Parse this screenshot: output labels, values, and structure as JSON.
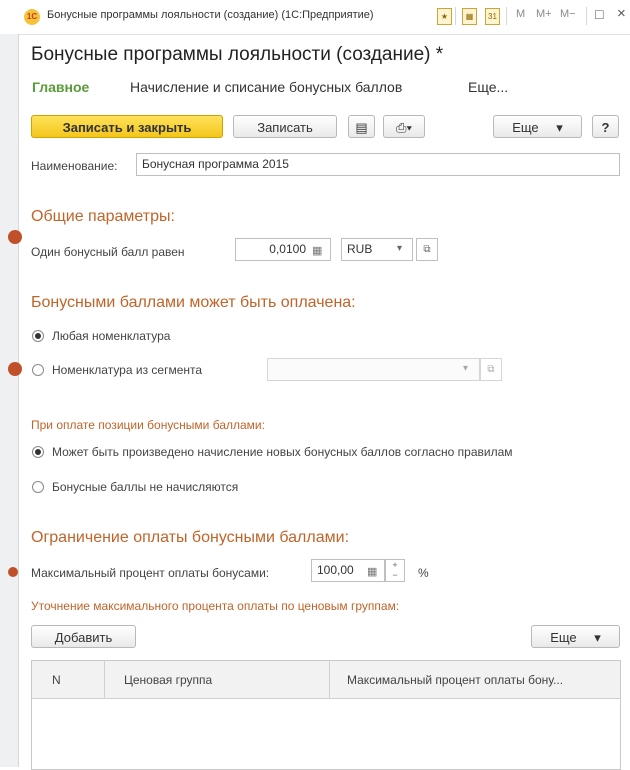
{
  "window": {
    "title": "Бонусные программы лояльности (создание)  (1С:Предприятие)",
    "title_icons": [
      "М",
      "М+",
      "М−"
    ],
    "maximize_glyph": "□",
    "close_glyph": "×"
  },
  "form": {
    "title": "Бонусные программы лояльности (создание) *"
  },
  "tabs": [
    {
      "label": "Главное"
    },
    {
      "label": "Начисление и списание бонусных баллов"
    },
    {
      "label": "Еще..."
    }
  ],
  "toolbar": {
    "save_close_label": "Записать и закрыть",
    "save_label": "Записать",
    "more_label": "Еще",
    "help_label": "?"
  },
  "name_field": {
    "label": "Наименование:",
    "value": "Бонусная программа 2015"
  },
  "general": {
    "heading": "Общие параметры:",
    "point_value_label": "Один бонусный балл равен",
    "point_value": "0,0100",
    "currency": "RUB"
  },
  "payable": {
    "heading": "Бонусными баллами может быть оплачена:",
    "option_any": "Любая номенклатура",
    "option_segment": "Номенклатура из сегмента",
    "segment_value": "",
    "selected": "any"
  },
  "payment": {
    "heading": "При оплате позиции бонусными баллами:",
    "option_accrue": "Может быть произведено начисление новых бонусных баллов согласно правилам",
    "option_no_accrue": "Бонусные баллы не начисляются",
    "selected": "accrue"
  },
  "limit": {
    "heading": "Ограничение оплаты бонусными баллами:",
    "max_percent_label": "Максимальный процент оплаты бонусами:",
    "max_percent": "100,00",
    "percent_sign": "%",
    "clarify_heading": "Уточнение максимального процента оплаты по ценовым группам:",
    "add_label": "Добавить",
    "more_label": "Еще"
  },
  "table": {
    "columns": [
      "N",
      "Ценовая группа",
      "Максимальный процент оплаты бону..."
    ],
    "rows": []
  }
}
